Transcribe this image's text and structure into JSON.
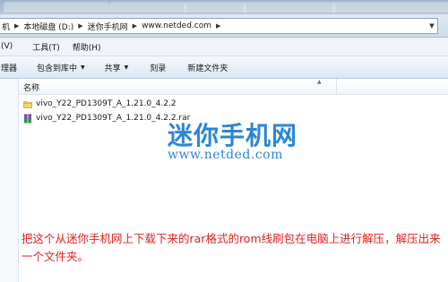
{
  "address_bar": {
    "crumbs": [
      "机",
      "本地磁盘 (D:)",
      "迷你手机网",
      "www.netded.com"
    ]
  },
  "menu": {
    "items": [
      "(V)",
      "工具(T)",
      "帮助(H)"
    ]
  },
  "toolbar": {
    "items": [
      {
        "label": "理器",
        "has_dropdown": false
      },
      {
        "label": "包含到库中",
        "has_dropdown": true
      },
      {
        "label": "共享",
        "has_dropdown": true
      },
      {
        "label": "刻录",
        "has_dropdown": false
      },
      {
        "label": "新建文件夹",
        "has_dropdown": false
      }
    ]
  },
  "file_list": {
    "column_name": "名称",
    "files": [
      {
        "name": "vivo_Y22_PD1309T_A_1.21.0_4.2.2",
        "icon": "folder-icon"
      },
      {
        "name": "vivo_Y22_PD1309T_A_1.21.0_4.2.2.rar",
        "icon": "winrar-archive-icon"
      }
    ]
  },
  "watermark": {
    "title": "迷你手机网",
    "url": "www.netded.com",
    "color": "#2c86d6"
  },
  "caption": {
    "text": "把这个从迷你手机网上下载下来的rar格式的rom线刷包在电脑上进行解压，解压出来一个文件夹。",
    "color": "#e0201f"
  }
}
